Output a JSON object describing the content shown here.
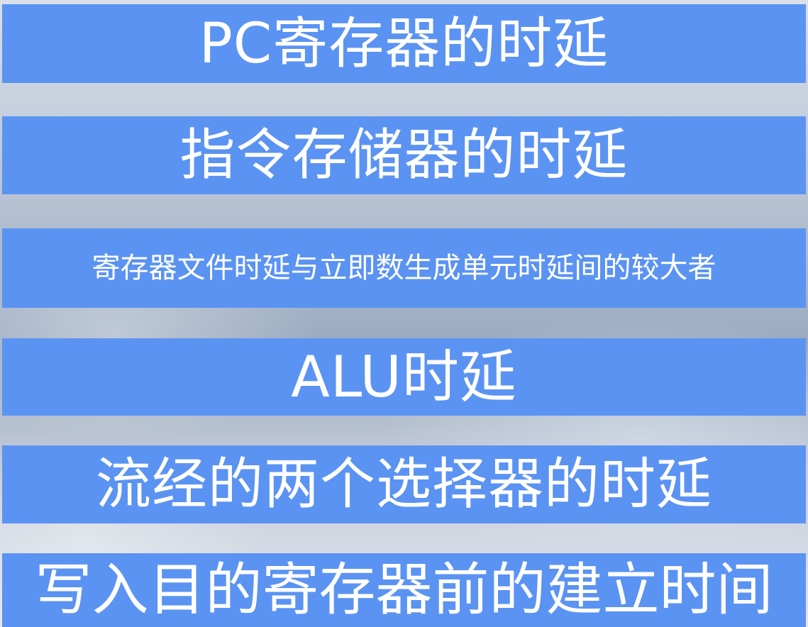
{
  "items": [
    {
      "label": "PC寄存器的时延"
    },
    {
      "label": "指令存储器的时延"
    },
    {
      "label": "寄存器文件时延与立即数生成单元时延间的较大者"
    },
    {
      "label": "ALU时延"
    },
    {
      "label": "流经的两个选择器的时延"
    },
    {
      "label": "写入目的寄存器前的建立时间"
    }
  ],
  "colors": {
    "bar": "#5b93f2",
    "text": "#ffffff"
  }
}
